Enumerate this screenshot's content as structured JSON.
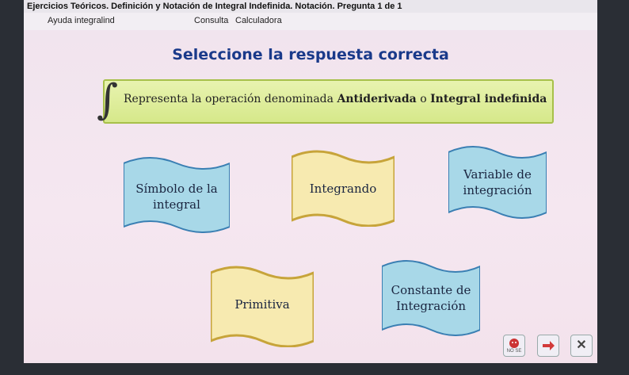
{
  "window": {
    "title": "Ejercicios Teóricos. Definición y Notación de Integral Indefinida. Notación. Pregunta 1 de 1"
  },
  "menu": {
    "items": [
      "Ayuda integralind",
      "Consulta",
      "Calculadora"
    ]
  },
  "main": {
    "heading": "Seleccione la respuesta correcta",
    "question_pre": "Representa la operación denominada ",
    "question_term1": "Antiderivada",
    "question_mid": " o ",
    "question_term2": "Integral indefinida",
    "integral_glyph": "∫"
  },
  "options": [
    {
      "line1": "Símbolo de la",
      "line2": "integral",
      "color": "#a8d8e8",
      "wave": "#3a7fb3"
    },
    {
      "line1": "Integrando",
      "line2": "",
      "color": "#f7eab0",
      "wave": "#c7a43a"
    },
    {
      "line1": "Variable de",
      "line2": "integración",
      "color": "#a8d8e8",
      "wave": "#3a7fb3"
    },
    {
      "line1": "Primitiva",
      "line2": "",
      "color": "#f7eab0",
      "wave": "#c7a43a"
    },
    {
      "line1": "Constante de",
      "line2": "Integración",
      "color": "#a8d8e8",
      "wave": "#3a7fb3"
    }
  ],
  "nav": {
    "help_icon": "face-icon",
    "help_caption": "NO SE",
    "next_icon": "arrow-right-icon",
    "close_icon": "close-icon",
    "close_glyph": "✕",
    "accent": "#d23a3a"
  }
}
